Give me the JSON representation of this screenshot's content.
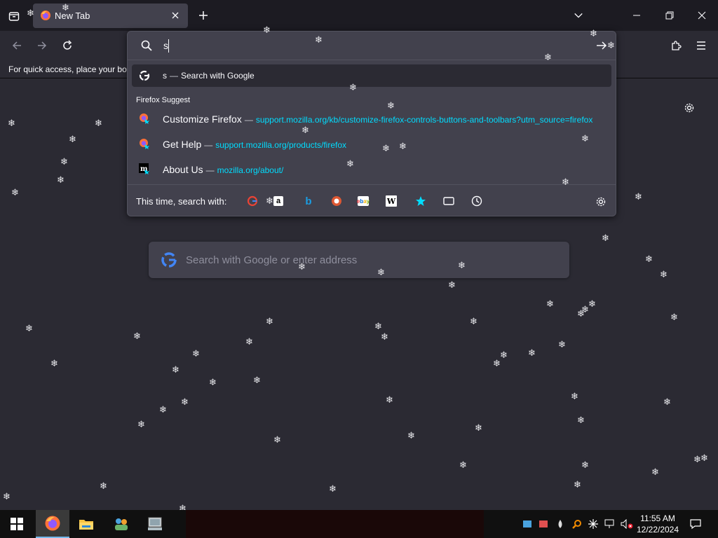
{
  "tab": {
    "title": "New Tab"
  },
  "urlbar": {
    "typed": "s"
  },
  "bookmarks_bar": {
    "text": "For quick access, place your boo"
  },
  "heuristic": {
    "text": "s",
    "dash": "—",
    "action": "Search with Google"
  },
  "suggest_group_title": "Firefox Suggest",
  "suggestions": [
    {
      "title": "Customize Firefox",
      "dash": "—",
      "url": "support.mozilla.org/kb/customize-firefox-controls-buttons-and-toolbars?utm_source=firefox",
      "icon": "firefox-icon"
    },
    {
      "title": "Get Help",
      "dash": "—",
      "url": "support.mozilla.org/products/firefox",
      "icon": "firefox-icon"
    },
    {
      "title": "About Us",
      "dash": "—",
      "url": "mozilla.org/about/",
      "icon": "mozilla-icon"
    }
  ],
  "footer": {
    "label": "This time, search with:"
  },
  "engines": [
    "google-icon",
    "amazon-icon",
    "bing-icon",
    "duckduckgo-icon",
    "ebay-icon",
    "wikipedia-icon",
    "bookmarks-icon",
    "tabs-icon",
    "history-icon"
  ],
  "newtab_search": {
    "placeholder": "Search with Google or enter address"
  },
  "taskbar": {
    "time": "11:55 AM",
    "date": "12/22/2024"
  },
  "colors": {
    "accent": "#00ddff",
    "panel": "#42414d",
    "page": "#2b2a33",
    "tabbar": "#1c1b22"
  }
}
